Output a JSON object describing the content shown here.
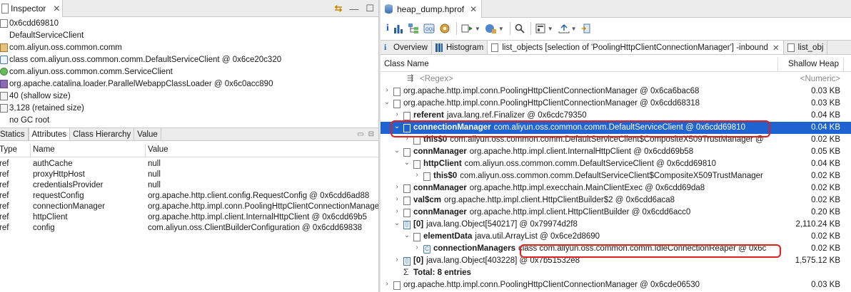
{
  "inspector": {
    "tab_label": "Inspector",
    "info_rows": [
      {
        "icon": "object-icon",
        "text": "0x6cdd69810"
      },
      {
        "icon": "class-name-icon",
        "text": "DefaultServiceClient"
      },
      {
        "icon": "package-icon",
        "text": "com.aliyun.oss.common.comm"
      },
      {
        "icon": "class-icon",
        "text": "class com.aliyun.oss.common.comm.DefaultServiceClient @ 0x6ce20c320"
      },
      {
        "icon": "superclass-icon",
        "text": "com.aliyun.oss.common.comm.ServiceClient"
      },
      {
        "icon": "classloader-icon",
        "text": "org.apache.catalina.loader.ParallelWebappClassLoader @ 0x6c0acc890"
      },
      {
        "icon": "shallow-size-icon",
        "text": "40 (shallow size)"
      },
      {
        "icon": "retained-size-icon",
        "text": "3,128 (retained size)"
      },
      {
        "icon": "gc-root-icon",
        "text": "no GC root"
      }
    ],
    "attr_tabs": [
      "Statics",
      "Attributes",
      "Class Hierarchy",
      "Value"
    ],
    "attr_active_tab": "Attributes",
    "attr_columns": {
      "type": "Type",
      "name": "Name",
      "value": "Value"
    },
    "attributes": [
      {
        "type": "ref",
        "name": "authCache",
        "value": "null"
      },
      {
        "type": "ref",
        "name": "proxyHttpHost",
        "value": "null"
      },
      {
        "type": "ref",
        "name": "credentialsProvider",
        "value": "null"
      },
      {
        "type": "ref",
        "name": "requestConfig",
        "value": "org.apache.http.client.config.RequestConfig @ 0x6cdd6ad88"
      },
      {
        "type": "ref",
        "name": "connectionManager",
        "value": "org.apache.http.impl.conn.PoolingHttpClientConnectionManager"
      },
      {
        "type": "ref",
        "name": "httpClient",
        "value": "org.apache.http.impl.client.InternalHttpClient @ 0x6cdd69b5"
      },
      {
        "type": "ref",
        "name": "config",
        "value": "com.aliyun.oss.ClientBuilderConfiguration @ 0x6cdd69838"
      }
    ]
  },
  "editor": {
    "tab_label": "heap_dump.hprof",
    "view_tabs": [
      {
        "label": "Overview",
        "icon": "info-icon"
      },
      {
        "label": "Histogram",
        "icon": "histogram-icon"
      },
      {
        "label": "list_objects [selection of 'PoolingHttpClientConnectionManager'] -inbound",
        "icon": "list-icon",
        "closable": true,
        "active": true
      },
      {
        "label": "list_obj",
        "icon": "list-icon"
      }
    ],
    "columns": {
      "class_name": "Class Name",
      "shallow_heap": "Shallow Heap"
    },
    "regex_row": {
      "label": "<Regex>",
      "value": "<Numeric>"
    },
    "rows": [
      {
        "depth": 0,
        "twisty": "›",
        "icon": "doc",
        "bold": "",
        "rest": "org.apache.http.impl.conn.PoolingHttpClientConnectionManager @ 0x6ca6bac68",
        "value": "0.03 KB"
      },
      {
        "depth": 0,
        "twisty": "⌄",
        "icon": "doc",
        "bold": "",
        "rest": "org.apache.http.impl.conn.PoolingHttpClientConnectionManager @ 0x6cdd68318",
        "value": "0.03 KB"
      },
      {
        "depth": 1,
        "twisty": "›",
        "icon": "doc",
        "bold": "referent",
        "rest": "java.lang.ref.Finalizer @ 0x6cdc79350",
        "value": "0.04 KB"
      },
      {
        "depth": 1,
        "twisty": "⌄",
        "icon": "doc",
        "bold": "connectionManager",
        "rest": "com.aliyun.oss.common.comm.DefaultServiceClient @ 0x6cdd69810",
        "value": "0.04 KB",
        "selected": true
      },
      {
        "depth": 2,
        "twisty": "›",
        "icon": "doc",
        "bold": "this$0",
        "rest": "com.aliyun.oss.common.comm.DefaultServiceClient$CompositeX509TrustManager @",
        "value": "0.02 KB"
      },
      {
        "depth": 1,
        "twisty": "⌄",
        "icon": "doc",
        "bold": "connManager",
        "rest": "org.apache.http.impl.client.InternalHttpClient @ 0x6cdd69b58",
        "value": "0.05 KB"
      },
      {
        "depth": 2,
        "twisty": "⌄",
        "icon": "doc",
        "bold": "httpClient",
        "rest": "com.aliyun.oss.common.comm.DefaultServiceClient @ 0x6cdd69810",
        "value": "0.04 KB"
      },
      {
        "depth": 3,
        "twisty": "›",
        "icon": "doc",
        "bold": "this$0",
        "rest": "com.aliyun.oss.common.comm.DefaultServiceClient$CompositeX509TrustManager",
        "value": "0.02 KB"
      },
      {
        "depth": 1,
        "twisty": "›",
        "icon": "doc",
        "bold": "connManager",
        "rest": "org.apache.http.impl.execchain.MainClientExec @ 0x6cdd69da8",
        "value": "0.02 KB"
      },
      {
        "depth": 1,
        "twisty": "›",
        "icon": "doc",
        "bold": "val$cm",
        "rest": "org.apache.http.impl.client.HttpClientBuilder$2 @ 0x6cdd6aca8",
        "value": "0.02 KB"
      },
      {
        "depth": 1,
        "twisty": "›",
        "icon": "doc",
        "bold": "connManager",
        "rest": "org.apache.http.impl.client.HttpClientBuilder @ 0x6cdd6acc0",
        "value": "0.20 KB"
      },
      {
        "depth": 1,
        "twisty": "⌄",
        "icon": "arr",
        "bold": "[0]",
        "rest": "java.lang.Object[540217] @ 0x79974d2f8",
        "value": "2,110.24 KB",
        "plain_bold": true
      },
      {
        "depth": 2,
        "twisty": "⌄",
        "icon": "doc",
        "bold": "elementData",
        "rest": "java.util.ArrayList @ 0x6ce2d8690",
        "value": "0.02 KB"
      },
      {
        "depth": 3,
        "twisty": "›",
        "icon": "cls",
        "bold": "connectionManagers",
        "rest": "class com.aliyun.oss.common.comm.IdleConnectionReaper @ 0x6c",
        "value": "0.02 KB",
        "boxed_rest": true
      },
      {
        "depth": 1,
        "twisty": "›",
        "icon": "arr",
        "bold": "[0]",
        "rest": "java.lang.Object[403228] @ 0x7b51532e8",
        "value": "1,575.12 KB",
        "plain_bold": true
      },
      {
        "depth": 1,
        "twisty": "",
        "icon": "sigma",
        "bold": "Total: 8 entries",
        "rest": "",
        "value": ""
      },
      {
        "depth": 0,
        "twisty": "›",
        "icon": "doc",
        "bold": "",
        "rest": "org.apache.http.impl.conn.PoolingHttpClientConnectionManager @ 0x6cde06530",
        "value": "0.03 KB"
      }
    ]
  },
  "colors": {
    "selection": "#1e63d0",
    "highlight_box": "#e02020",
    "accent_arrows": "#c98a00"
  }
}
